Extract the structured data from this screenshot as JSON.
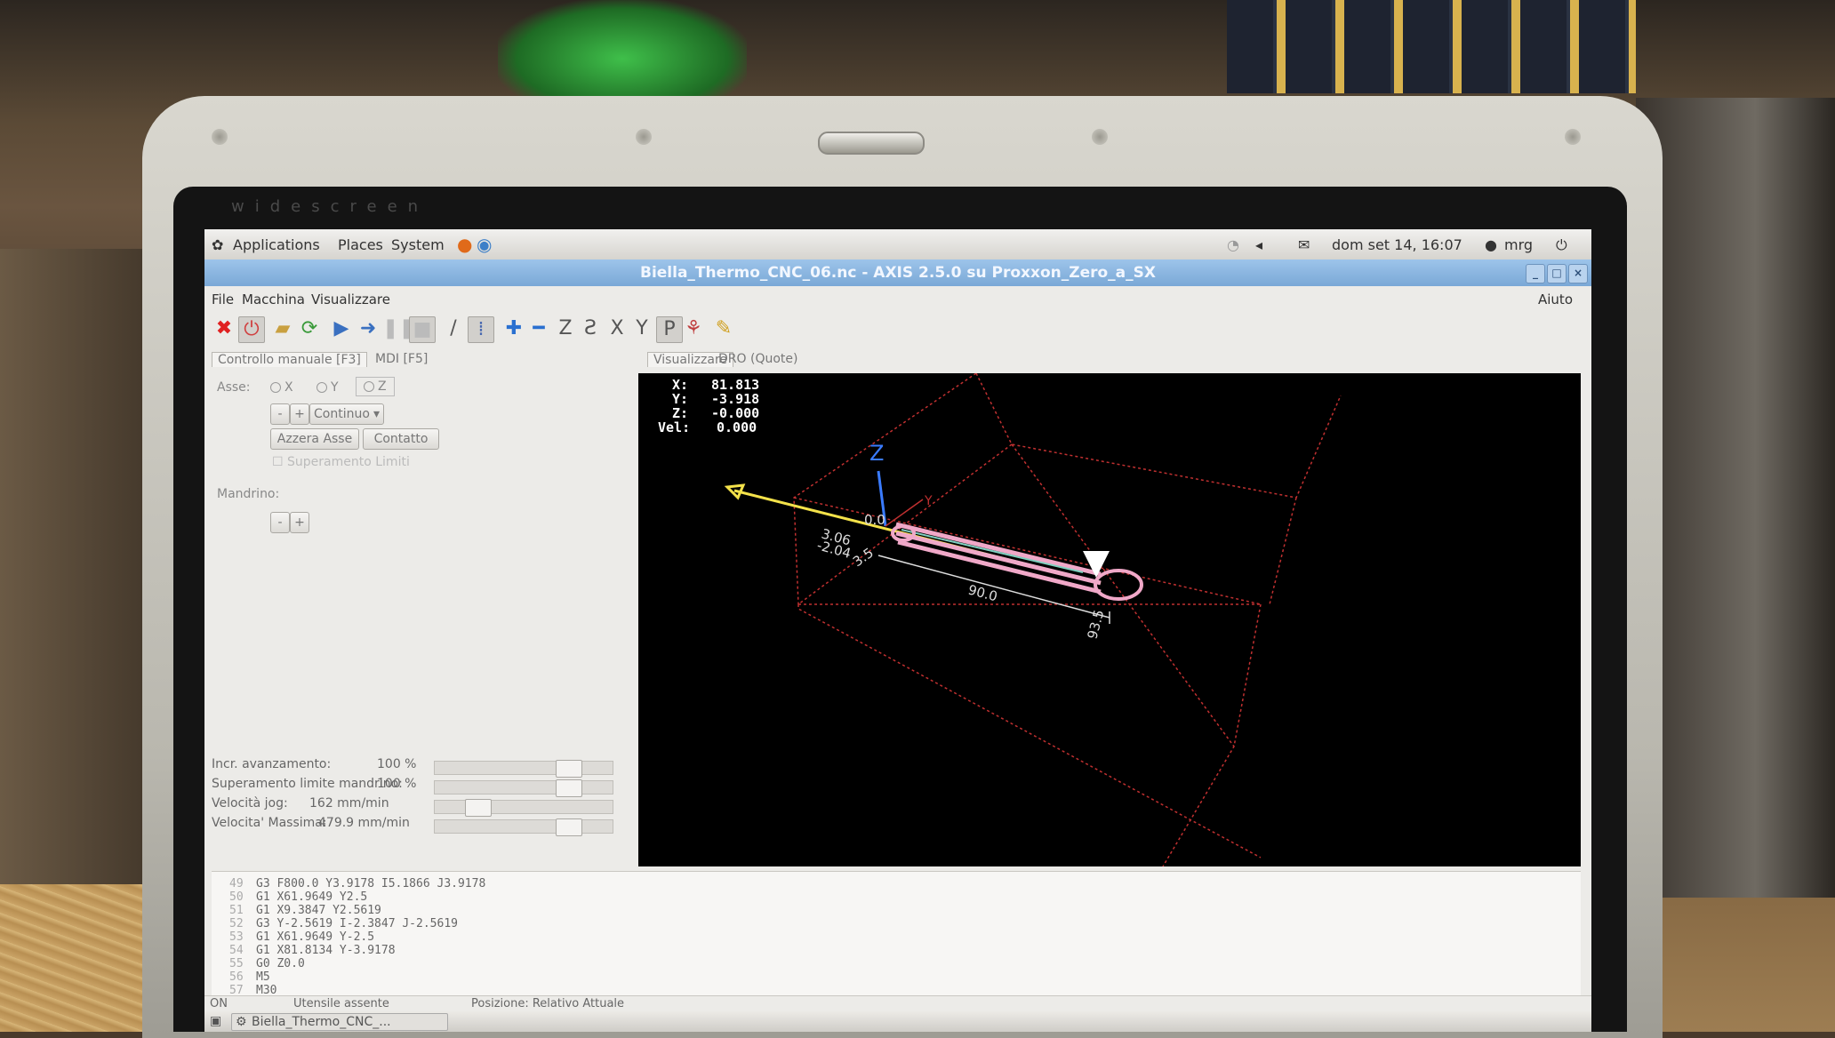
{
  "photo": {
    "bezel_brand": "widescreen"
  },
  "panel": {
    "applications": "Applications",
    "places": "Places",
    "system": "System",
    "datetime": "dom set 14, 16:07",
    "user": "mrg"
  },
  "window": {
    "title": "Biella_Thermo_CNC_06.nc - AXIS 2.5.0 su Proxxon_Zero_a_SX"
  },
  "menu": {
    "file": "File",
    "machine": "Macchina",
    "view": "Visualizzare",
    "help": "Aiuto"
  },
  "left_tabs": {
    "manual": "Controllo manuale [F3]",
    "mdi": "MDI [F5]"
  },
  "right_tabs": {
    "preview": "Visualizzare",
    "dro": "DRO (Quote)"
  },
  "manual": {
    "axis_label": "Asse:",
    "axis_x": "X",
    "axis_y": "Y",
    "axis_z": "Z",
    "minus": "-",
    "plus": "+",
    "jog_mode": "Continuo",
    "home_button": "Azzera Asse",
    "touch_button": "Contatto",
    "override_limits": "Superamento Limiti",
    "spindle_label": "Mandrino:",
    "spindle_minus": "-",
    "spindle_plus": "+"
  },
  "sliders": {
    "feed_label": "Incr. avanzamento:",
    "feed_value": "100 %",
    "feed_fraction": 0.8,
    "spindle_label": "Superamento limite mandrino:",
    "spindle_value": "100 %",
    "spindle_fraction": 0.8,
    "jog_label": "Velocità jog:",
    "jog_value": "162 mm/min",
    "jog_fraction": 0.2,
    "max_label": "Velocita' Massima:",
    "max_value": "479.9 mm/min",
    "max_fraction": 0.8
  },
  "dro": {
    "x_label": "X:",
    "x_value": "81.813",
    "y_label": "Y:",
    "y_value": "-3.918",
    "z_label": "Z:",
    "z_value": "-0.000",
    "vel_label": "Vel:",
    "vel_value": "0.000"
  },
  "preview_labels": {
    "z_axis": "Z",
    "y_axis": "Y",
    "dim_length": "90.0",
    "dim_max": "93.5",
    "dim_small": "3.5",
    "dim_a": "3.06",
    "dim_b": "-2.04",
    "dim_c": "0.0"
  },
  "colors": {
    "toolpath_feed": "#f0a8c8",
    "toolpath_rapid": "#f4e24a",
    "axis_z": "#3a7bff",
    "limits_box": "#c03030",
    "titlebar": "#86b0dc"
  },
  "gcode": [
    {
      "n": "49",
      "code": "G3 F800.0 Y3.9178 I5.1866 J3.9178"
    },
    {
      "n": "50",
      "code": "G1 X61.9649 Y2.5"
    },
    {
      "n": "51",
      "code": "G1 X9.3847 Y2.5619"
    },
    {
      "n": "52",
      "code": "G3 Y-2.5619 I-2.3847 J-2.5619"
    },
    {
      "n": "53",
      "code": "G1 X61.9649 Y-2.5"
    },
    {
      "n": "54",
      "code": "G1 X81.8134 Y-3.9178"
    },
    {
      "n": "55",
      "code": "G0 Z0.0"
    },
    {
      "n": "56",
      "code": "M5"
    },
    {
      "n": "57",
      "code": "M30"
    }
  ],
  "status": {
    "state": "ON",
    "tool": "Utensile assente",
    "position": "Posizione: Relativo Attuale"
  },
  "taskbar": {
    "task": "Biella_Thermo_CNC_..."
  }
}
